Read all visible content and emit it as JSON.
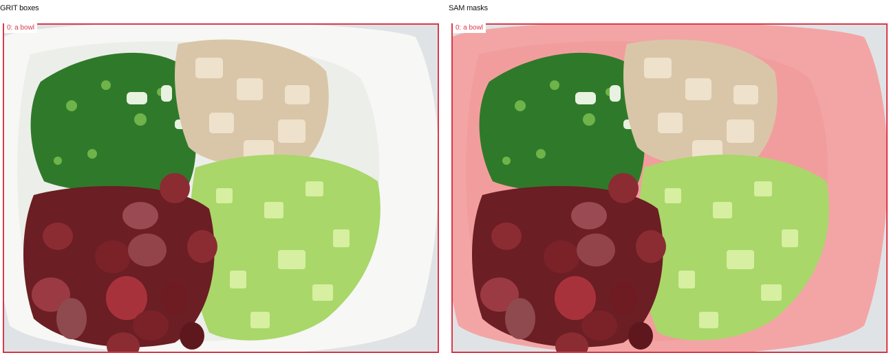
{
  "panels": [
    {
      "title": "GRIT boxes",
      "box_label": "0: a bowl",
      "box_color": "#d9394a"
    },
    {
      "title": "SAM masks",
      "box_label": "0: a bowl",
      "box_color": "#d9394a",
      "mask_color": "#f08080"
    }
  ],
  "photo": {
    "subject": "salad bowl with chopped green onion, chicken, grapes and celery",
    "colors": {
      "background": "#e9ecef",
      "bowl": "#f7f7f5",
      "onion": "#2f7a2a",
      "chicken": "#d9c6a8",
      "grapes": "#7a2228",
      "celery": "#a9d76a"
    }
  }
}
